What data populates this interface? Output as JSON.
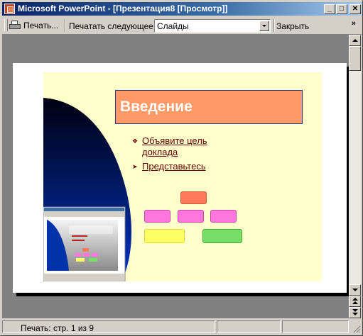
{
  "window": {
    "title": "Microsoft PowerPoint - [Презентация8 [Просмотр]]",
    "controls": {
      "minimize": "_",
      "maximize": "□",
      "close": "✕"
    }
  },
  "toolbar": {
    "print_label": "Печать...",
    "print_what_label": "Печатать следующее:",
    "print_what_value": "Слайды",
    "close_label": "Закрыть",
    "overflow": "»"
  },
  "slide": {
    "title": "Введение",
    "bullets": [
      "Объявите цель доклада",
      "Представьтесь"
    ],
    "colors": {
      "background": "#ffffcc",
      "title_box": "#ff9966",
      "top_box": "#ff7a5c",
      "middle_boxes": "#ff77dd",
      "left_bottom_box": "#ffff66",
      "right_bottom_box": "#77dd66"
    }
  },
  "status": {
    "page_info": "Печать: стр. 1 из 9"
  }
}
